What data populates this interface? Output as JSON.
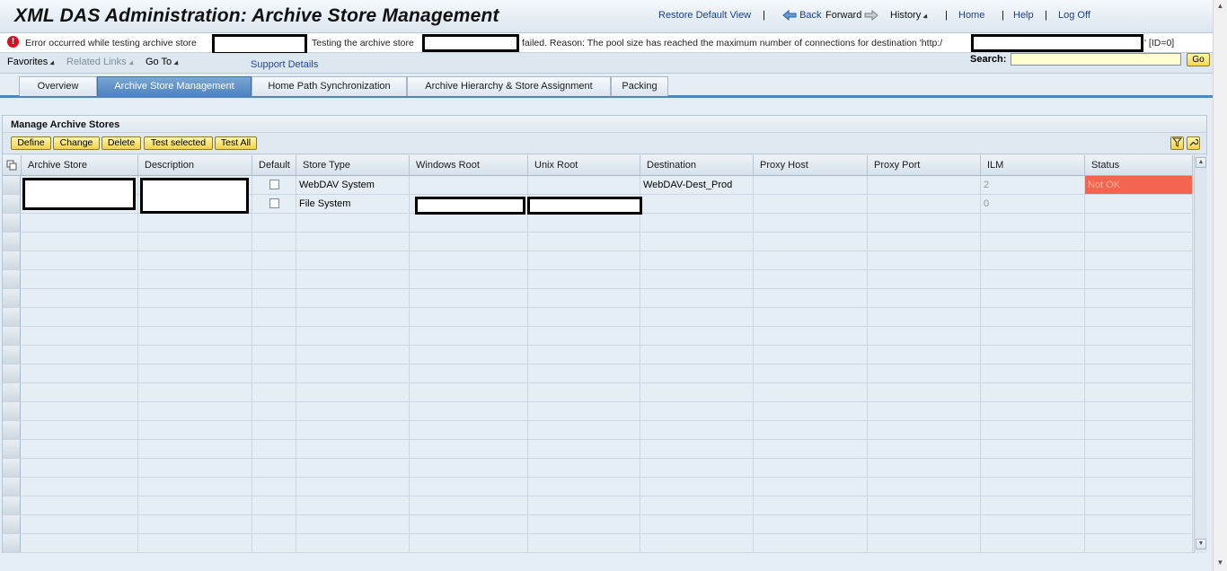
{
  "header": {
    "title": "XML DAS Administration: Archive Store Management",
    "nav": {
      "restore_default_view": "Restore Default View",
      "back": "Back",
      "forward": "Forward",
      "history": "History",
      "home": "Home",
      "help": "Help",
      "log_off": "Log Off",
      "separator": "|"
    }
  },
  "message": {
    "part1": "Error occurred while testing archive store",
    "part2": "Testing the archive store",
    "part3": "failed. Reason: The pool size has reached the maximum number of connections for destination 'http:/",
    "part4": "' [ID=0]"
  },
  "menu": {
    "favorites": "Favorites",
    "related_links": "Related Links",
    "go_to": "Go To",
    "support_details": "Support Details",
    "search_label": "Search:",
    "search_value": "",
    "go_button": "Go"
  },
  "tabs": [
    {
      "label": "Overview",
      "active": false
    },
    {
      "label": "Archive Store Management",
      "active": true
    },
    {
      "label": "Home Path Synchronization",
      "active": false
    },
    {
      "label": "Archive Hierarchy & Store Assignment",
      "active": false
    },
    {
      "label": "Packing",
      "active": false
    }
  ],
  "panel": {
    "title": "Manage Archive Stores",
    "toolbar": {
      "define": "Define",
      "change": "Change",
      "delete": "Delete",
      "test_selected": "Test selected",
      "test_all": "Test All"
    }
  },
  "table": {
    "columns": [
      "Archive Store",
      "Description",
      "Default",
      "Store Type",
      "Windows Root",
      "Unix Root",
      "Destination",
      "Proxy Host",
      "Proxy Port",
      "ILM",
      "Status"
    ],
    "rows": [
      {
        "store_type": "WebDAV System",
        "destination": "WebDAV-Dest_Prod",
        "ilm": "2",
        "status": "Not OK"
      },
      {
        "store_type": "File System",
        "destination": "",
        "ilm": "0",
        "status": ""
      }
    ],
    "status_bad_color": "#f5644f"
  }
}
